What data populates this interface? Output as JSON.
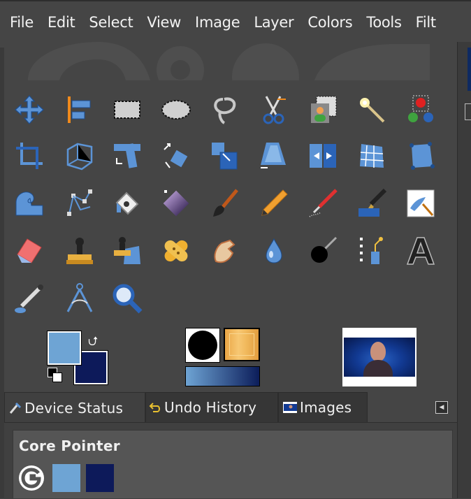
{
  "menu": [
    "File",
    "Edit",
    "Select",
    "View",
    "Image",
    "Layer",
    "Colors",
    "Tools",
    "Filt"
  ],
  "tools": [
    {
      "name": "move-tool-icon"
    },
    {
      "name": "align-tool-icon"
    },
    {
      "name": "rect-select-tool-icon"
    },
    {
      "name": "ellipse-select-tool-icon"
    },
    {
      "name": "free-select-tool-icon"
    },
    {
      "name": "scissors-select-tool-icon"
    },
    {
      "name": "foreground-select-tool-icon"
    },
    {
      "name": "fuzzy-select-tool-icon"
    },
    {
      "name": "select-by-color-tool-icon"
    },
    {
      "name": "crop-tool-icon"
    },
    {
      "name": "unified-transform-tool-icon"
    },
    {
      "name": "rotate-tool-icon"
    },
    {
      "name": "shear-tool-icon"
    },
    {
      "name": "scale-tool-icon"
    },
    {
      "name": "perspective-tool-icon"
    },
    {
      "name": "flip-tool-icon"
    },
    {
      "name": "cage-transform-tool-icon"
    },
    {
      "name": "handle-transform-tool-icon"
    },
    {
      "name": "warp-transform-tool-icon"
    },
    {
      "name": "paths-tool-icon"
    },
    {
      "name": "bucket-fill-tool-icon"
    },
    {
      "name": "gradient-tool-icon"
    },
    {
      "name": "paintbrush-tool-icon"
    },
    {
      "name": "pencil-tool-icon"
    },
    {
      "name": "airbrush-tool-icon"
    },
    {
      "name": "ink-tool-icon"
    },
    {
      "name": "mypaint-brush-tool-icon"
    },
    {
      "name": "eraser-tool-icon"
    },
    {
      "name": "clone-tool-icon"
    },
    {
      "name": "perspective-clone-tool-icon"
    },
    {
      "name": "heal-tool-icon"
    },
    {
      "name": "smudge-tool-icon"
    },
    {
      "name": "blur-sharpen-tool-icon"
    },
    {
      "name": "dodge-burn-tool-icon"
    },
    {
      "name": "n-point-deformation-tool-icon"
    },
    {
      "name": "text-tool-icon"
    },
    {
      "name": "color-picker-tool-icon"
    },
    {
      "name": "measure-tool-icon"
    },
    {
      "name": "zoom-tool-icon"
    }
  ],
  "colors": {
    "foreground": "#6ea4d4",
    "background": "#0d1a5a"
  },
  "tabs": [
    {
      "label": "Device Status"
    },
    {
      "label": "Undo History"
    },
    {
      "label": "Images"
    }
  ],
  "device_status": {
    "title": "Core Pointer"
  }
}
